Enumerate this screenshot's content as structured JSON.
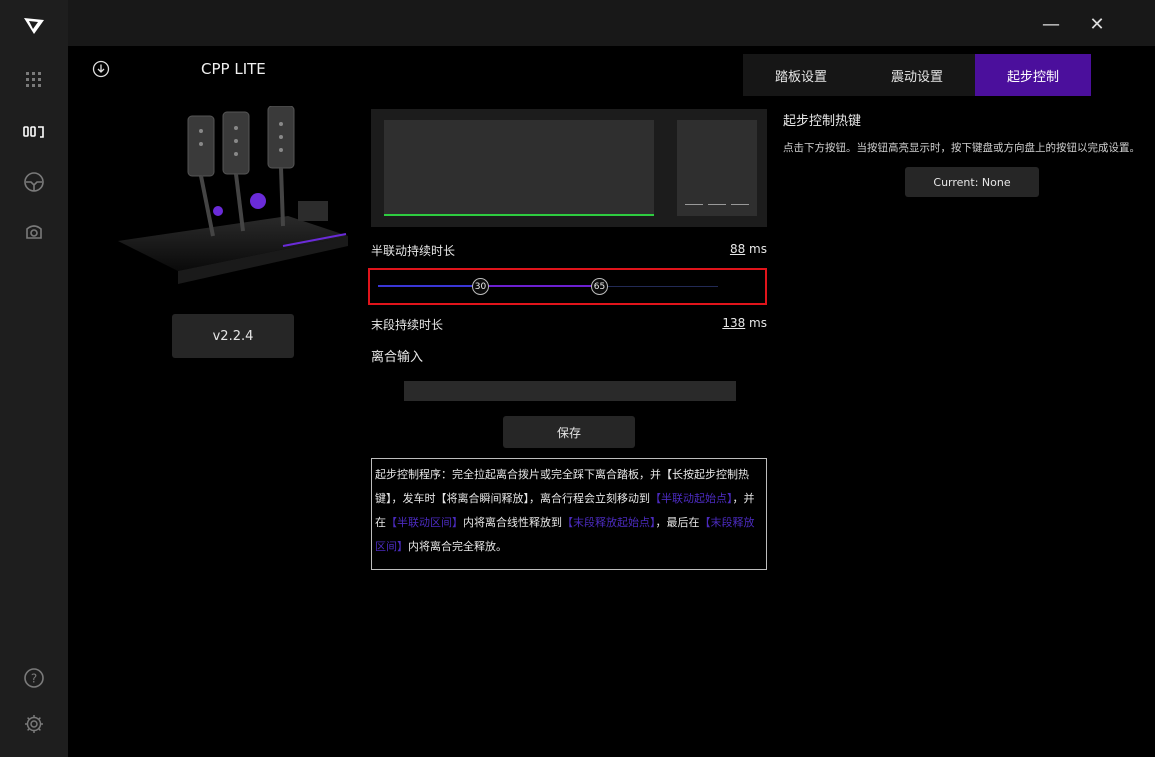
{
  "window": {
    "minimize_symbol": "—",
    "close_symbol": "✕"
  },
  "sidebar": {
    "items": [
      {
        "icon": "logo-icon"
      },
      {
        "icon": "grid-icon"
      },
      {
        "icon": "pedals-icon"
      },
      {
        "icon": "steering-wheel-icon"
      },
      {
        "icon": "base-icon"
      },
      {
        "icon": "help-icon",
        "label": "?"
      },
      {
        "icon": "gear-icon"
      }
    ]
  },
  "device": {
    "name": "CPP LITE",
    "firmware_label": "v2.2.4"
  },
  "tabs": [
    {
      "label": "踏板设置",
      "active": false
    },
    {
      "label": "震动设置",
      "active": false
    },
    {
      "label": "起步控制",
      "active": true
    }
  ],
  "settings": {
    "half_link_label": "半联动持续时长",
    "half_link_value": "88",
    "unit_ms": "ms",
    "slider_low": "30",
    "slider_high": "65",
    "slider_low_fraction": 0.3,
    "slider_high_fraction": 0.65,
    "end_label": "末段持续时长",
    "end_value": "138",
    "clutch_input_label": "离合输入",
    "save_label": "保存"
  },
  "description": {
    "parts": [
      {
        "text": "起步控制程序：完全拉起离合拨片或完全踩下离合踏板，并【长按起步控制热键】，发车时【将离合瞬间释放】，离合行程会立刻移动到",
        "highlight": false
      },
      {
        "text": "【半联动起始点】",
        "highlight": true
      },
      {
        "text": "，并在",
        "highlight": false
      },
      {
        "text": "【半联动区间】",
        "highlight": true
      },
      {
        "text": "内将离合线性释放到",
        "highlight": false
      },
      {
        "text": "【末段释放起始点】",
        "highlight": true
      },
      {
        "text": "，最后在",
        "highlight": false
      },
      {
        "text": "【末段释放区间】",
        "highlight": true
      },
      {
        "text": "内将离合完全释放。",
        "highlight": false
      }
    ]
  },
  "hotkey": {
    "title": "起步控制热键",
    "instruction": "点击下方按钮。当按钮高亮显示时，按下键盘或方向盘上的按钮以完成设置。",
    "current_label": "Current: None"
  },
  "colors": {
    "accent": "#4b0f9c",
    "graph_line": "#2ecc40",
    "slider_highlight_border": "#e0141b",
    "highlight_text": "#4b2bbf"
  }
}
